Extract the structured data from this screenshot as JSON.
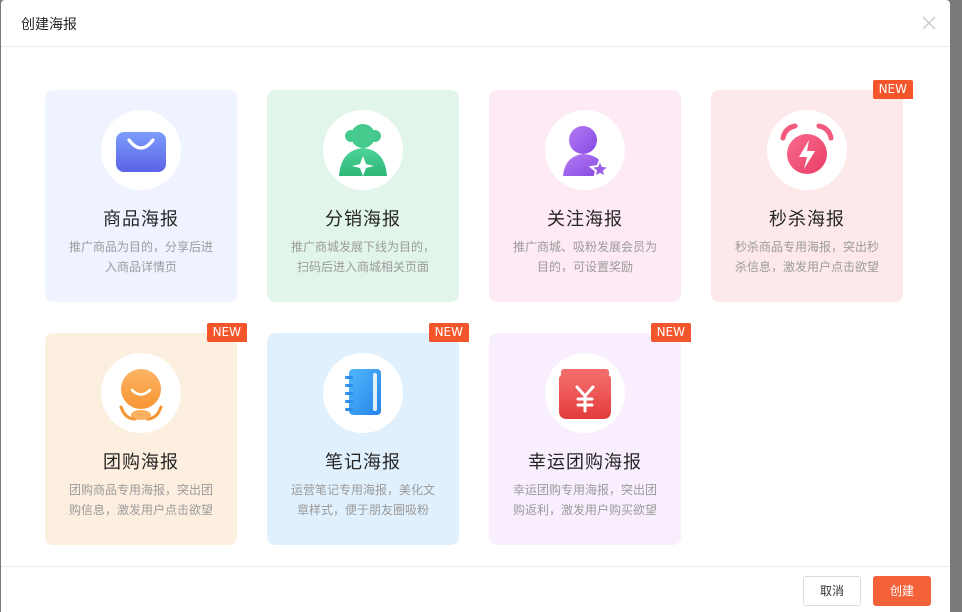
{
  "dialog": {
    "title": "创建海报"
  },
  "cards": [
    {
      "title": "商品海报",
      "desc": "推广商品为目的，分享后进入商品详情页",
      "icon": "shopping-bag-icon",
      "bg": "#eff3ff",
      "badge": ""
    },
    {
      "title": "分销海报",
      "desc": "推广商城发展下线为目的，扫码后进入商城相关页面",
      "icon": "distribution-user-icon",
      "bg": "#e2f5ea",
      "badge": ""
    },
    {
      "title": "关注海报",
      "desc": "推广商城、吸粉发展会员为目的，可设置奖励",
      "icon": "follow-user-icon",
      "bg": "#fdeaf4",
      "badge": ""
    },
    {
      "title": "秒杀海报",
      "desc": "秒杀商品专用海报，突出秒杀信息，激发用户点击欲望",
      "icon": "alarm-clock-icon",
      "bg": "#fde9ea",
      "badge": "NEW"
    },
    {
      "title": "团购海报",
      "desc": "团购商品专用海报，突出团购信息，激发用户点击欲望",
      "icon": "group-smile-icon",
      "bg": "#fdefdf",
      "badge": "NEW"
    },
    {
      "title": "笔记海报",
      "desc": "运营笔记专用海报，美化文章样式，便于朋友圈吸粉",
      "icon": "notebook-icon",
      "bg": "#e0f0fd",
      "badge": "NEW"
    },
    {
      "title": "幸运团购海报",
      "desc": "幸运团购专用海报，突出团购返利，激发用户购买欲望",
      "icon": "red-envelope-icon",
      "bg": "#f9eefd",
      "badge": "NEW"
    }
  ],
  "footer": {
    "cancel_label": "取消",
    "create_label": "创建"
  }
}
